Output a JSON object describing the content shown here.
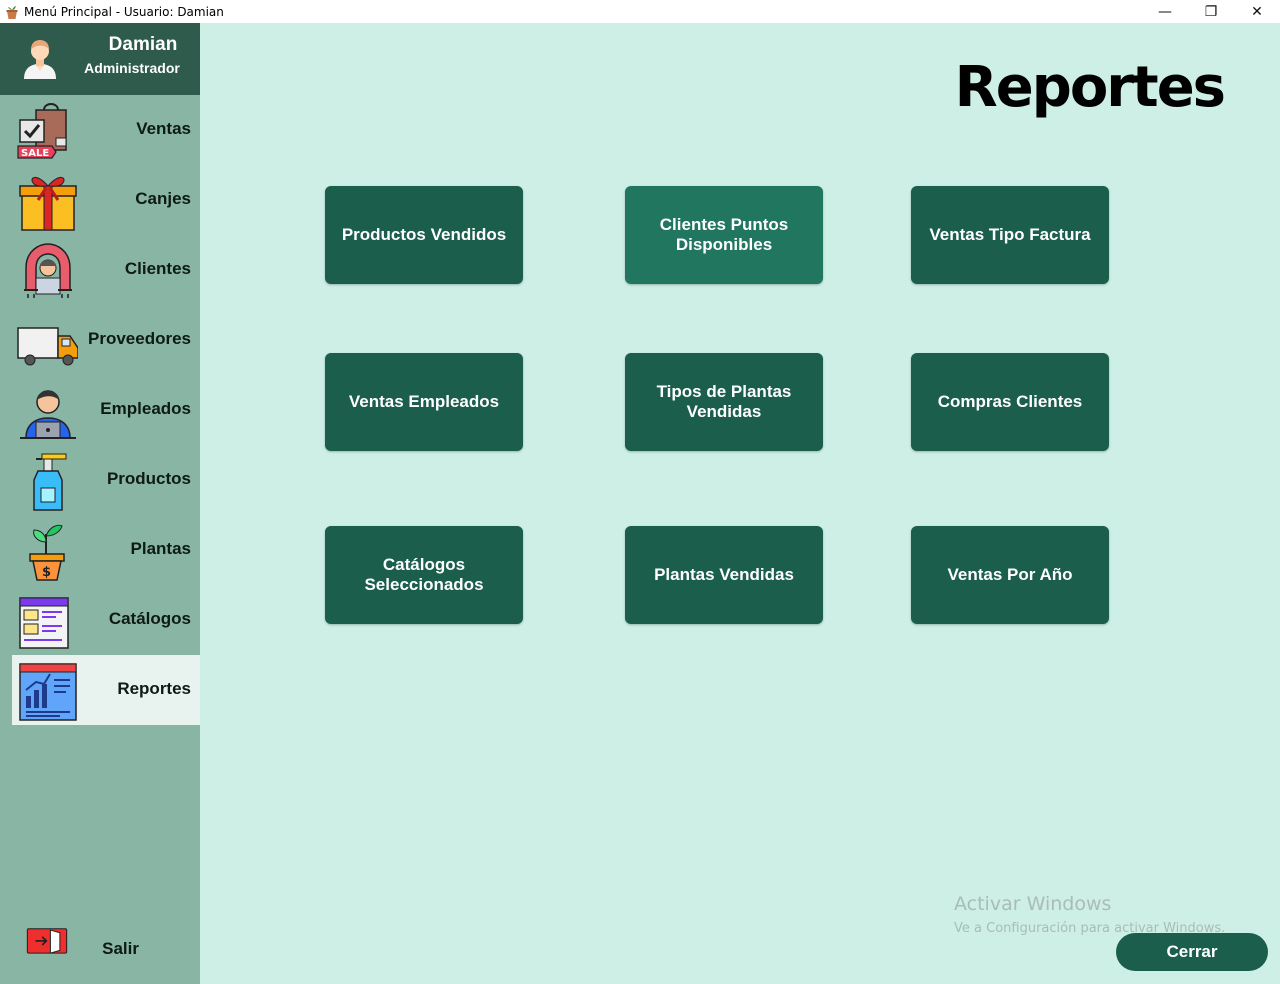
{
  "window": {
    "title": "Menú Principal - Usuario: Damian",
    "controls": {
      "minimize": "—",
      "restore": "❐",
      "close": "✕"
    }
  },
  "user": {
    "name": "Damian",
    "role": "Administrador"
  },
  "sidebar": {
    "items": [
      {
        "label": "Ventas",
        "icon": "sale-bag-icon"
      },
      {
        "label": "Canjes",
        "icon": "gift-icon"
      },
      {
        "label": "Clientes",
        "icon": "customer-icon"
      },
      {
        "label": "Proveedores",
        "icon": "truck-icon"
      },
      {
        "label": "Empleados",
        "icon": "employee-icon"
      },
      {
        "label": "Productos",
        "icon": "spray-bottle-icon"
      },
      {
        "label": "Plantas",
        "icon": "plant-pot-icon"
      },
      {
        "label": "Catálogos",
        "icon": "catalog-icon"
      },
      {
        "label": "Reportes",
        "icon": "report-icon",
        "active": true
      }
    ],
    "logout": {
      "label": "Salir",
      "icon": "exit-door-icon"
    }
  },
  "main": {
    "title": "Reportes",
    "reports": [
      {
        "label": "Productos Vendidos"
      },
      {
        "label": "Clientes Puntos Disponibles"
      },
      {
        "label": "Ventas Tipo Factura"
      },
      {
        "label": "Ventas Empleados"
      },
      {
        "label": "Tipos de Plantas Vendidas"
      },
      {
        "label": "Compras Clientes"
      },
      {
        "label": "Catálogos Seleccionados"
      },
      {
        "label": "Plantas Vendidas"
      },
      {
        "label": "Ventas Por Año"
      }
    ],
    "close_label": "Cerrar"
  },
  "watermark": {
    "title": "Activar Windows",
    "subtitle": "Ve a Configuración para activar Windows."
  },
  "colors": {
    "sidebar_bg": "#89b5a5",
    "user_panel_bg": "#2f5b4c",
    "main_bg": "#cdefe5",
    "button_bg": "#1a5e4b",
    "button_hover_bg": "#217660"
  }
}
